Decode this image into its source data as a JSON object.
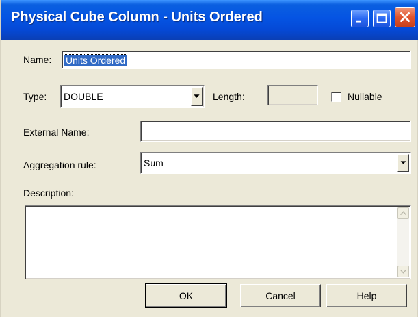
{
  "window": {
    "title": "Physical Cube Column - Units Ordered",
    "controls": {
      "minimize": "minimize-icon",
      "maximize": "maximize-icon",
      "close": "close-icon"
    }
  },
  "form": {
    "name_label": "Name:",
    "name_value": "Units Ordered",
    "type_label": "Type:",
    "type_value": "DOUBLE",
    "length_label": "Length:",
    "length_value": "",
    "nullable_label": "Nullable",
    "nullable_checked": false,
    "external_name_label": "External Name:",
    "external_name_value": "",
    "aggregation_label": "Aggregation rule:",
    "aggregation_value": "Sum",
    "description_label": "Description:",
    "description_value": ""
  },
  "buttons": {
    "ok": "OK",
    "cancel": "Cancel",
    "help": "Help"
  },
  "colors": {
    "titlebar": "#0554e3",
    "dialog_bg": "#ece9d8",
    "selection": "#316ac5"
  }
}
